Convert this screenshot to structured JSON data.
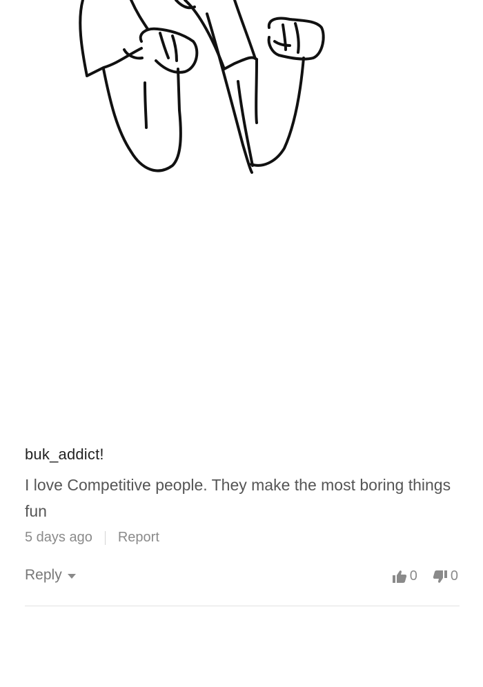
{
  "comment": {
    "username": "buk_addict!",
    "text": "I love Competitive people. They make the most boring things fun",
    "time_ago": "5 days ago",
    "report_label": "Report"
  },
  "actions": {
    "reply_label": "Reply",
    "upvotes": "0",
    "downvotes": "0"
  },
  "icons": {
    "reply_caret": "chevron-down-icon",
    "upvote": "thumbs-up-icon",
    "downvote": "thumbs-down-icon"
  }
}
